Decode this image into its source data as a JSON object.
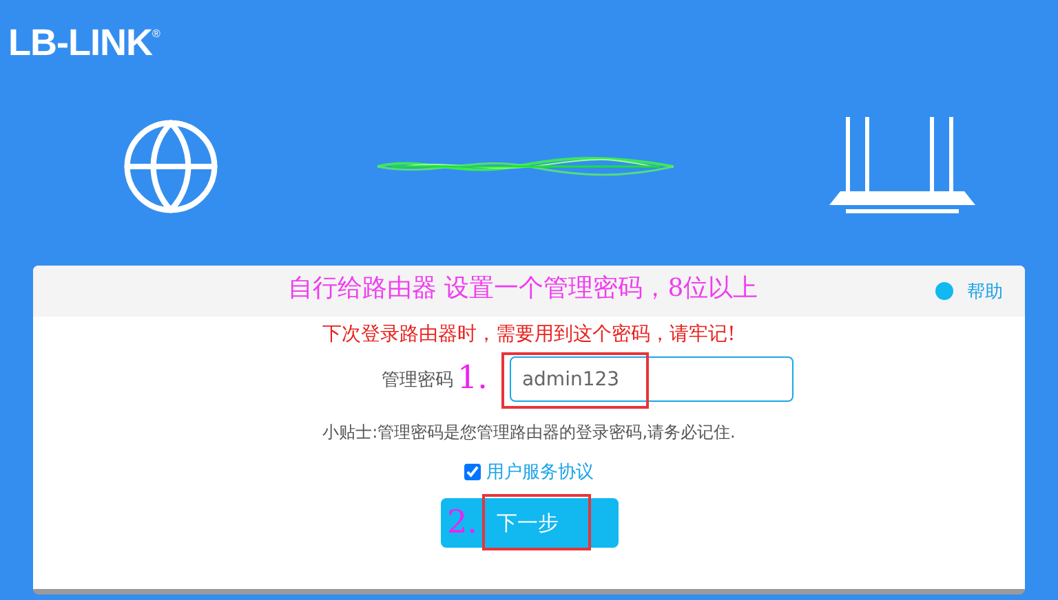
{
  "brand": {
    "logo": "LB-LINK",
    "mark": "®"
  },
  "card": {
    "title_note": "自行给路由器  设置一个管理密码，8位以上",
    "help": "帮助",
    "notice": "下次登录路由器时，需要用到这个密码，请牢记!",
    "password": {
      "label": "管理密码",
      "marker": "1.",
      "value": "admin123"
    },
    "tip": "小贴士:管理密码是您管理路由器的登录密码,请务必记住.",
    "agreement": {
      "label": "用户服务协议",
      "checked": true
    },
    "next_button": {
      "marker": "2.",
      "label": "下一步"
    }
  }
}
